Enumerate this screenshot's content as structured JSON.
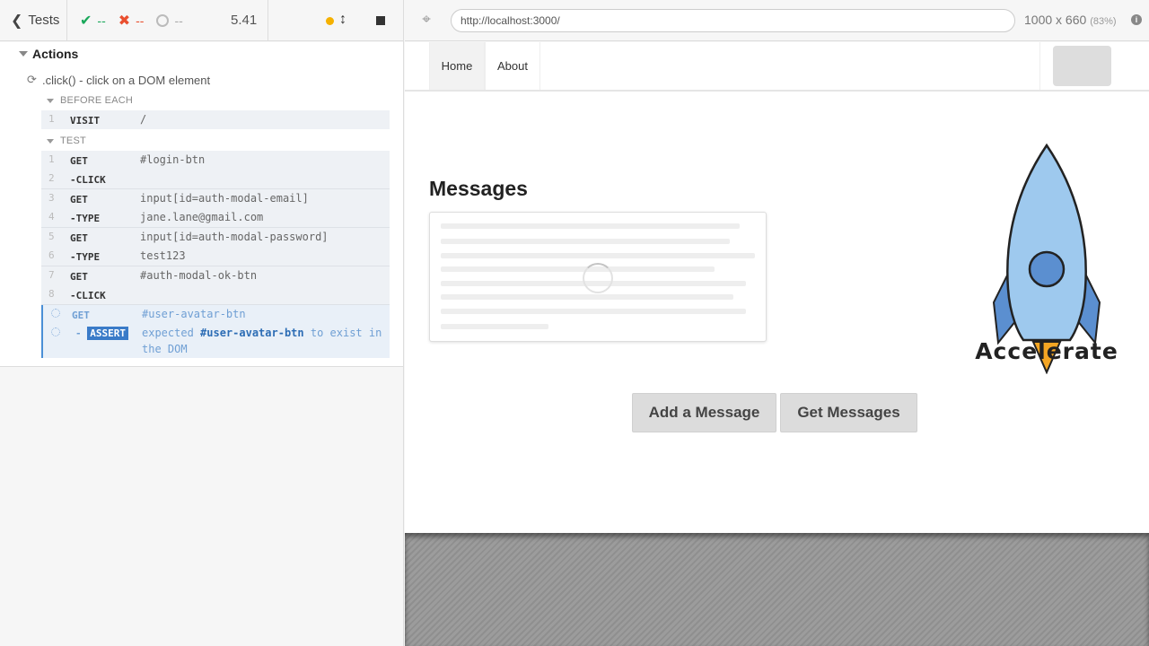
{
  "header": {
    "tests_label": "Tests",
    "passed": "--",
    "failed": "--",
    "pending": "--",
    "duration": "5.41"
  },
  "spec": {
    "suite": "Actions",
    "test": ".click() - click on a DOM element",
    "before_each_label": "BEFORE EACH",
    "test_label": "TEST",
    "before_each": [
      {
        "num": "1",
        "name": "VISIT",
        "msg": "/"
      }
    ],
    "commands": [
      {
        "num": "1",
        "name": "GET",
        "msg": "#login-btn"
      },
      {
        "num": "2",
        "name": "-CLICK",
        "msg": ""
      },
      {
        "num": "3",
        "name": "GET",
        "msg": "input[id=auth-modal-email]"
      },
      {
        "num": "4",
        "name": "-TYPE",
        "msg": "jane.lane@gmail.com"
      },
      {
        "num": "5",
        "name": "GET",
        "msg": "input[id=auth-modal-password]"
      },
      {
        "num": "6",
        "name": "-TYPE",
        "msg": "test123"
      },
      {
        "num": "7",
        "name": "GET",
        "msg": "#auth-modal-ok-btn"
      },
      {
        "num": "8",
        "name": "-CLICK",
        "msg": ""
      }
    ],
    "pending": {
      "get_name": "GET",
      "get_msg": "#user-avatar-btn",
      "assert_prefix": "-",
      "assert_name": "ASSERT",
      "assert_msg_1": "expected",
      "assert_selector": "#user-avatar-btn",
      "assert_msg_2": "to exist in",
      "assert_msg_3": "the DOM"
    }
  },
  "browser": {
    "url": "http://localhost:3000/",
    "viewport": "1000 x 660",
    "zoom": "(83%)"
  },
  "app": {
    "nav_home": "Home",
    "nav_about": "About",
    "messages_title": "Messages",
    "brand": "Accelerate",
    "add_button": "Add a Message",
    "get_button": "Get Messages"
  },
  "colors": {
    "passed": "#1aa85a",
    "failed": "#e94f2f",
    "running_dot": "#f5b100",
    "assert_badge": "#3a7bc8",
    "rocket_body": "#9ec9ee",
    "rocket_fins": "#5b8fd0",
    "rocket_flame": "#f5a623"
  }
}
